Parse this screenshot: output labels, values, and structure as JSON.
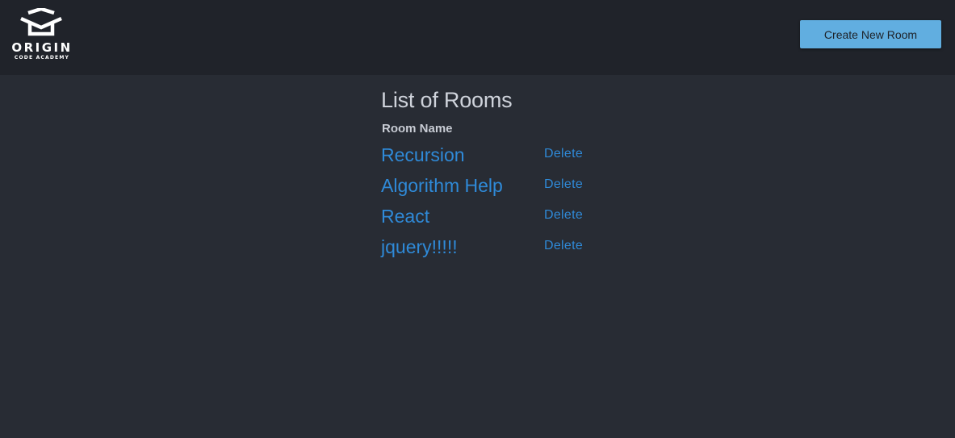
{
  "header": {
    "logo": {
      "icon": "graduation-cap-icon",
      "title": "ORIGIN",
      "subtitle": "CODE ACADEMY"
    },
    "create_button_label": "Create New Room"
  },
  "main": {
    "title": "List of Rooms",
    "column_header": "Room Name",
    "rooms": [
      {
        "name": "Recursion",
        "delete_label": "Delete"
      },
      {
        "name": "Algorithm Help",
        "delete_label": "Delete"
      },
      {
        "name": "React",
        "delete_label": "Delete"
      },
      {
        "name": "jquery!!!!!",
        "delete_label": "Delete"
      }
    ]
  },
  "colors": {
    "header_bg": "#20232a",
    "page_bg": "#282c34",
    "button_bg": "#61aee0",
    "link": "#2f8ad8",
    "title_text": "#cfd3db"
  }
}
